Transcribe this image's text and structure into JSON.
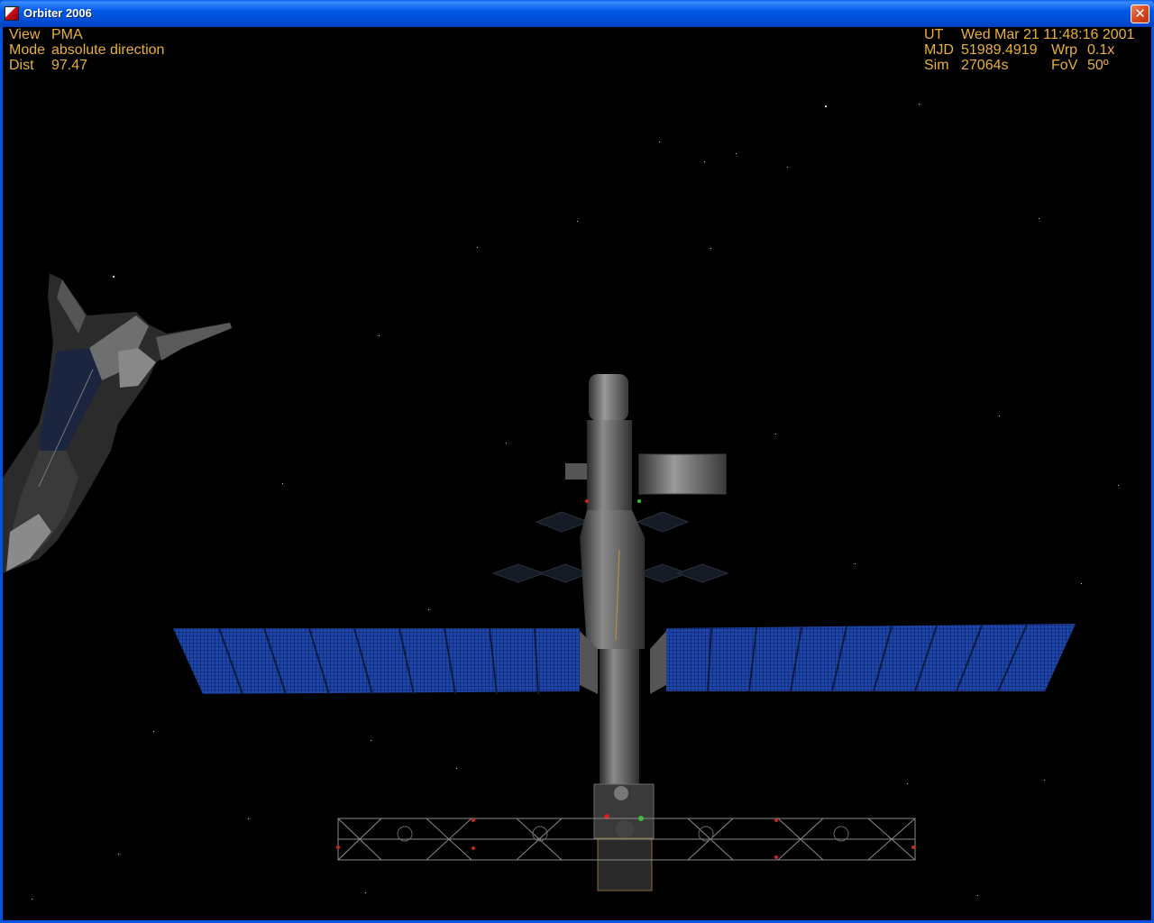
{
  "window": {
    "title": "Orbiter 2006",
    "icon": "orbiter-app-icon",
    "close_icon": "close-icon"
  },
  "hud_left": {
    "view_label": "View",
    "view_value": "PMA",
    "mode_label": "Mode",
    "mode_value": "absolute direction",
    "dist_label": "Dist",
    "dist_value": "97.47"
  },
  "hud_right": {
    "ut_label": "UT",
    "ut_value": "Wed Mar 21 11:48:16 2001",
    "mjd_label": "MJD",
    "mjd_value": "51989.4919",
    "warp_label": "Wrp",
    "warp_value": "0.1x",
    "sim_label": "Sim",
    "sim_value": "27064s",
    "fov_label": "FoV",
    "fov_value": "50º"
  },
  "colors": {
    "hud_text": "#e8b13a",
    "titlebar": "#0054e3",
    "background": "#000000"
  }
}
